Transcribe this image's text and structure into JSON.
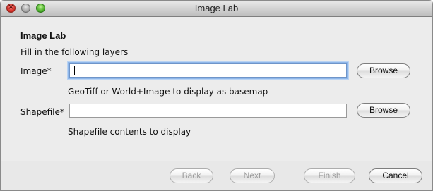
{
  "window": {
    "title": "Image Lab"
  },
  "header": {
    "title": "Image Lab",
    "subtitle": "Fill in the following layers"
  },
  "fields": [
    {
      "label": "Image*",
      "value": "",
      "hint": "GeoTiff or World+Image to display as basemap",
      "button": "Browse"
    },
    {
      "label": "Shapefile*",
      "value": "",
      "hint": "Shapefile contents to display",
      "button": "Browse"
    }
  ],
  "footer": {
    "back": "Back",
    "next": "Next",
    "finish": "Finish",
    "cancel": "Cancel"
  },
  "colors": {
    "focus_ring": "#8fb7ea",
    "close": "#d8322a",
    "zoom": "#4fb22d"
  }
}
